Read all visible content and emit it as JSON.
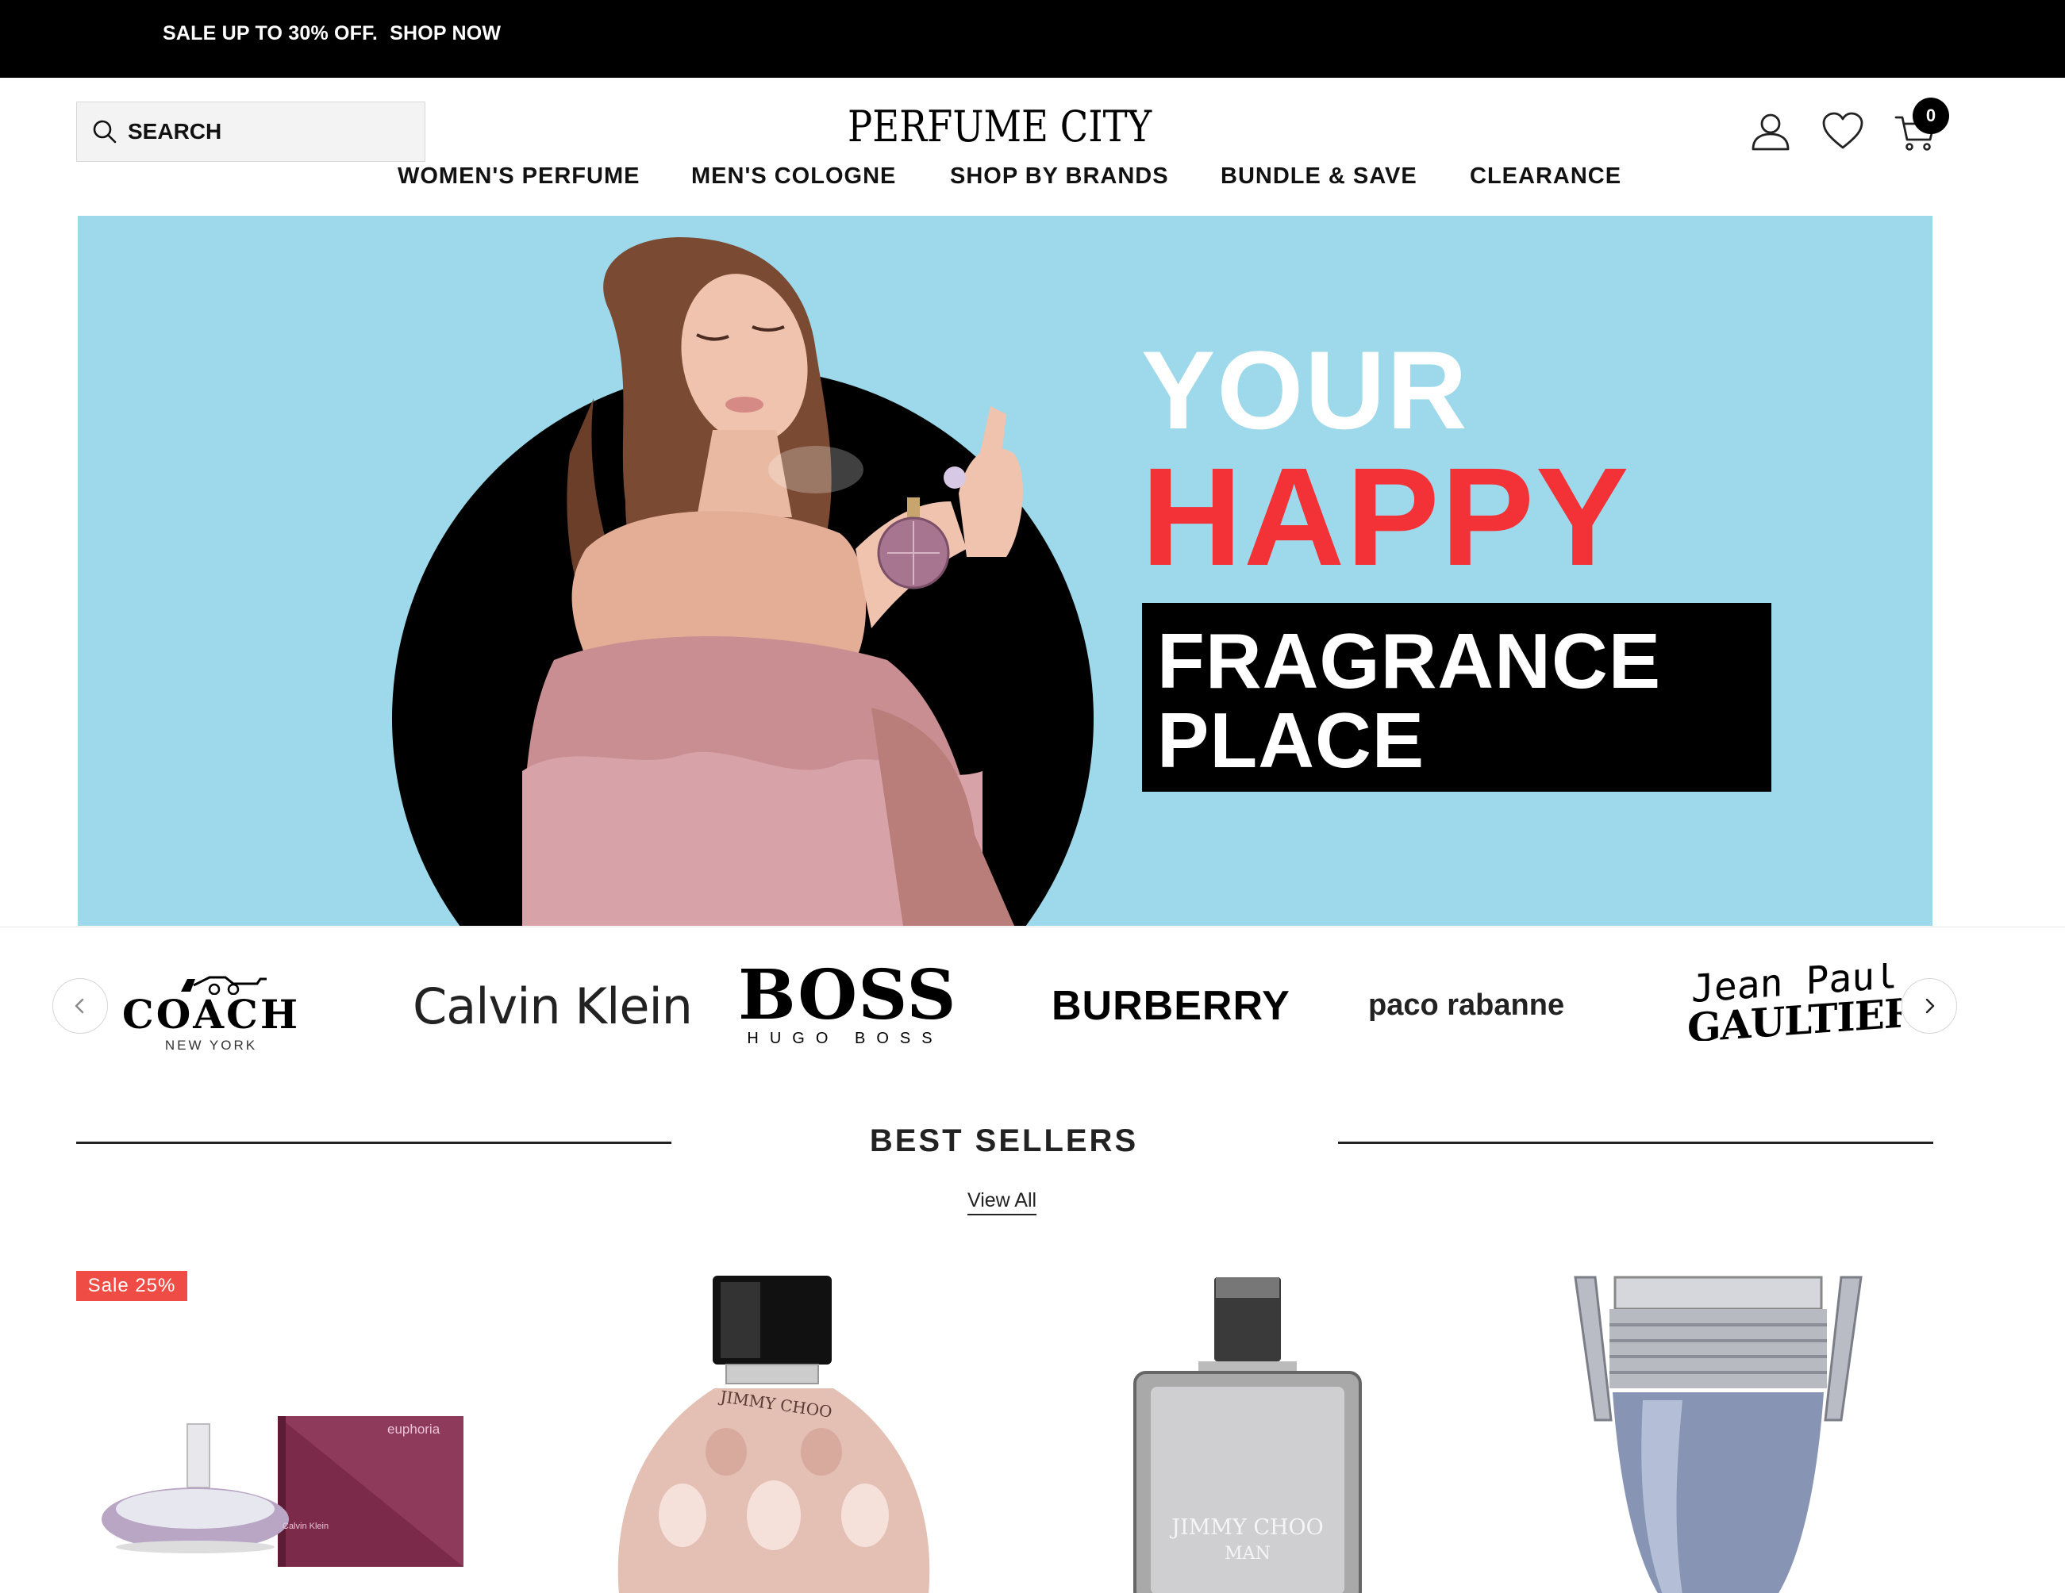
{
  "announcement": {
    "sale_text": "SALE UP TO 30% OFF.",
    "link_text": "SHOP NOW"
  },
  "search": {
    "placeholder": "SEARCH"
  },
  "brand": {
    "logo": "PERFUME CITY"
  },
  "cart": {
    "count": "0"
  },
  "nav": {
    "items": [
      {
        "label": "WOMEN'S PERFUME"
      },
      {
        "label": "MEN'S COLOGNE"
      },
      {
        "label": "SHOP BY BRANDS"
      },
      {
        "label": "BUNDLE & SAVE"
      },
      {
        "label": "CLEARANCE"
      }
    ]
  },
  "hero": {
    "line1": "YOUR",
    "line2": "HAPPY",
    "line3": "FRAGRANCE",
    "line4": "PLACE",
    "colors": {
      "background": "#9dd9ea",
      "accent": "#f33238"
    }
  },
  "brands": {
    "coach": {
      "name": "COACH",
      "sub": "NEW YORK"
    },
    "calvin_klein": {
      "name": "Calvin Klein"
    },
    "boss": {
      "name": "BOSS",
      "sub": "HUGO BOSS"
    },
    "burberry": {
      "name": "BURBERRY"
    },
    "paco_rabanne": {
      "name": "paco rabanne"
    },
    "jean_paul_gaultier": {
      "name_line1": "Jean Paul",
      "name_line2": "GAULTIER"
    }
  },
  "best_sellers": {
    "title": "BEST SELLERS",
    "view_all": "View All",
    "products": [
      {
        "badge": "Sale 25%",
        "box_text": "euphoria",
        "box_brand": "Calvin Klein"
      },
      {
        "bottle_text": "JIMMY CHOO"
      },
      {
        "bottle_text_line1": "JIMMY CHOO",
        "bottle_text_line2": "MAN"
      },
      {
        "name": ""
      }
    ]
  }
}
